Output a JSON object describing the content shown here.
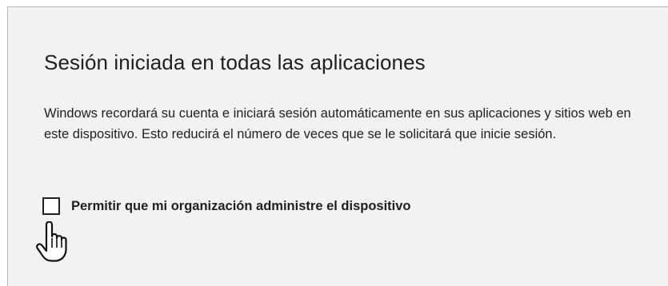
{
  "dialog": {
    "title": "Sesión iniciada en todas las aplicaciones",
    "description": "Windows recordará su cuenta e iniciará sesión automáticamente en sus aplicaciones y sitios web en este dispositivo. Esto reducirá el número de veces que se le solicitará que inicie sesión.",
    "checkbox": {
      "label": "Permitir que mi organización administre el dispositivo",
      "checked": false
    }
  },
  "cursor": {
    "icon": "hand-pointer-icon"
  }
}
